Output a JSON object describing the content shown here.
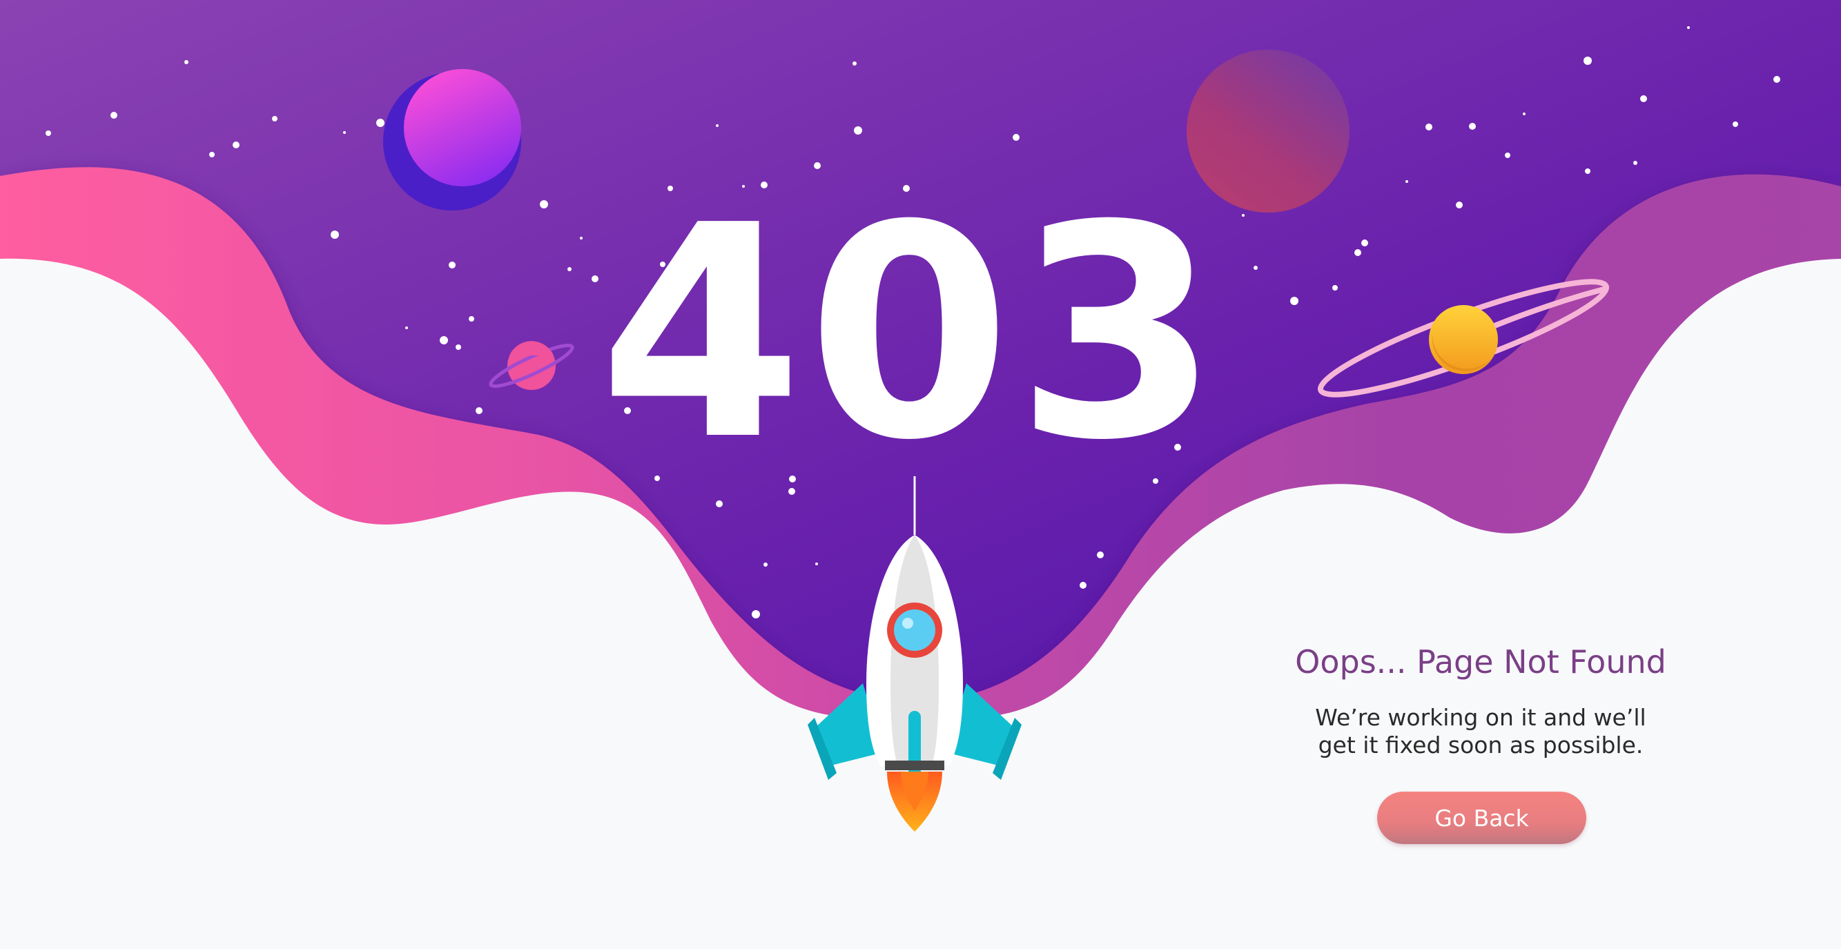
{
  "error_code": "403",
  "message": {
    "title": "Oops... Page Not Found",
    "line1": "We’re working on it and we’ll",
    "line2": "get it fixed soon as possible."
  },
  "go_back_label": "Go Back",
  "colors": {
    "sky_start": "#8a3fb0",
    "sky_end": "#4c10aa",
    "pink_wave": "#ff5fa2",
    "magenta_wave": "#a743a5",
    "page_bg": "#f8f9fb",
    "title_color": "#7a3f86",
    "button_color": "#f4837f",
    "rocket_wing": "#12bfd2",
    "rocket_window": "#e8453c"
  },
  "icons": [
    "rocket-icon",
    "planet-icon",
    "ringed-planet-icon",
    "star-icon"
  ]
}
